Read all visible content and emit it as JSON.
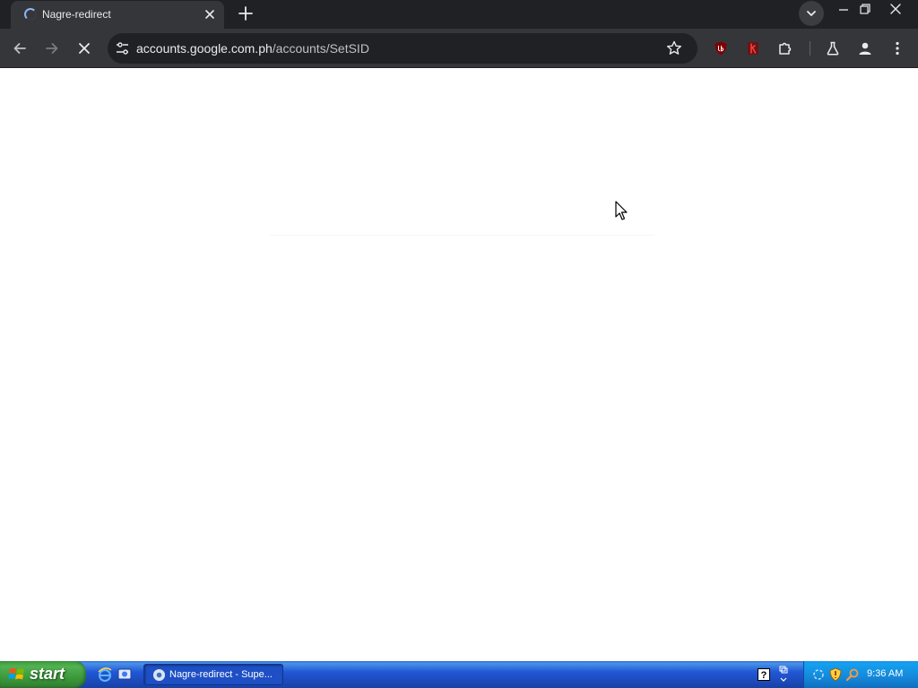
{
  "browser": {
    "tab": {
      "title": "Nagre-redirect",
      "loading": true
    },
    "address_bar": {
      "host": "accounts.google.com.ph",
      "path": "/accounts/SetSID"
    },
    "theme": {
      "frame": "#202124",
      "toolbar": "#35363a",
      "omnibox": "#202124",
      "text": "#e8eaed"
    },
    "icons": {
      "back": "back-arrow-icon",
      "forward": "forward-arrow-icon",
      "stop": "stop-x-icon",
      "site_info": "tune-icon",
      "bookmark": "star-icon",
      "ublock": "ublock-origin-icon",
      "ext2": "red-extension-icon",
      "extensions": "puzzle-icon",
      "labs": "flask-icon",
      "profile": "person-icon",
      "menu": "kebab-menu-icon"
    }
  },
  "taskbar": {
    "start_label": "start",
    "task_button_label": "Nagre-redirect - Supe...",
    "clock": "9:36 AM",
    "colors": {
      "bar": "#245edb",
      "start": "#3c9a3c",
      "tray": "#1590e4"
    }
  }
}
